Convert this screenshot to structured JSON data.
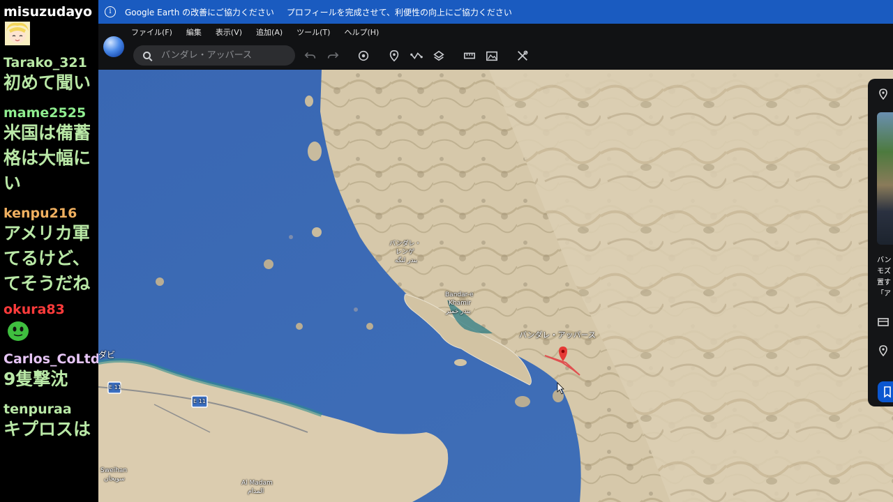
{
  "chat": {
    "messages": [
      {
        "user": "misuzudayo",
        "user_color": "#ffffff",
        "text": "",
        "emoji": "yellow-hair-avatar"
      },
      {
        "user": "Tarako_321",
        "user_color": "#b9e8a6",
        "text": "初めて聞い",
        "emoji": ""
      },
      {
        "user": "mame2525",
        "user_color": "#90ee90",
        "text": "米国は備蓄",
        "text2": "格は大幅に",
        "text3": "い",
        "emoji": ""
      },
      {
        "user": "kenpu216",
        "user_color": "#f0b060",
        "text": "アメリカ軍",
        "text2": "てるけど、",
        "text3": "てそうだね",
        "emoji": ""
      },
      {
        "user": "okura83",
        "user_color": "#ff3b3b",
        "text": "",
        "emoji": "green-blob-avatar"
      },
      {
        "user": "Carlos_CoLtd",
        "user_color": "#e6c5f5",
        "text": "9隻撃沈",
        "emoji": ""
      },
      {
        "user": "tenpuraa",
        "user_color": "#b9e8a6",
        "text": "キプロスは",
        "emoji": ""
      }
    ]
  },
  "infobar": {
    "message1": "Google Earth の改善にご協力ください",
    "message2": "プロフィールを完成させて、利便性の向上にご協力ください"
  },
  "menu": [
    "ファイル(F)",
    "編集",
    "表示(V)",
    "追加(A)",
    "ツール(T)",
    "ヘルプ(H)"
  ],
  "search": {
    "placeholder": "バンダレ・アッバース"
  },
  "map": {
    "labels": {
      "bandar_abbas": "バンダレ・アッバース",
      "bandar_lengeh_1": "バンダレ・",
      "bandar_lengeh_2": "レンゲ",
      "bandar_lengeh_3": "بندر لنگه",
      "bandar_khamir_1": "Bandar-e",
      "bandar_khamir_2": "Khamir",
      "bandar_khamir_3": "بندر خمیر",
      "dubai": "ダビ",
      "route_e11": "E 11",
      "route_e11b": "E 11",
      "sweihan_1": "Sweihan",
      "sweihan_2": "سويحان",
      "al_madam_1": "Al Madam",
      "al_madam_2": "المدام"
    },
    "colors": {
      "sea": "#3c68b0",
      "land": "#d8ccb0",
      "marker": "#e53935"
    }
  },
  "sidepanel": {
    "text1": "バン",
    "text2": "モズ",
    "text3": "置す",
    "text4": "「ア"
  }
}
